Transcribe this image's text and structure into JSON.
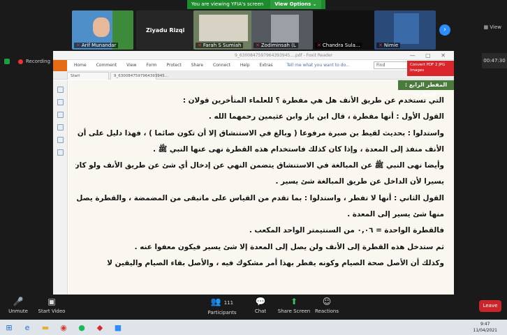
{
  "banner": {
    "viewing": "You are viewing YFIA's screen",
    "options": "View Options ⌄"
  },
  "participants": [
    {
      "name": "Arif Munandar",
      "bg": "#4f8fc9"
    },
    {
      "name": "Ziyadu Rizqi",
      "bg": "#262626"
    },
    {
      "name": "Farah S Sumiah",
      "bg": "#6d7f5e"
    },
    {
      "name": "Zodiminsah (L",
      "bg": "#555a60"
    },
    {
      "name": "Chandra Sula...",
      "bg": "#111"
    },
    {
      "name": "Nimie",
      "bg": "#2a4a7a"
    }
  ],
  "view_label": "View",
  "status": {
    "recording": "Recording",
    "timer": "00:47:30"
  },
  "app": {
    "title": "9_6300847597964393945....pdf - Foxit Reader",
    "menu": [
      "Home",
      "Comment",
      "View",
      "Form",
      "Protect",
      "Share",
      "Connect",
      "Help",
      "Extras"
    ],
    "tellme": "Tell me what you want to do...",
    "find": "Find",
    "convert": "Convert\nPDF 2 JPG Images",
    "tabs": [
      "Start",
      "9_6300847597964393945..."
    ]
  },
  "doc": {
    "header": "المفطر الرابع : القطرة",
    "lines": [
      "التي تستخدم عن طريق الأنف هل هي مفطرة ؟ للعلماء المتأخرين قولان :",
      "القول الأول : أنها مفطرة ، قال ابن باز وابن عثيمين رحمهما الله .",
      "واستدلوا : بحديث لقيط بن صبرة مرفوعا ( وبالغ في الاستنشاق إلا أن تكون صائما ) ، فهذا دليل على أن",
      "الأنف منفذ إلى المعدة ، وإذا كان كذلك فاستخدام هذه القطرة نهى عنها النبي ﷺ .",
      "وأيضا نهى النبي ﷺ عن المبالغة في الاستنشاق يتضمن النهي عن إدخال أي شئ عن طريق الأنف ولو كان",
      "يسيرا لأن الداخل عن طريق المبالغة شئ يسير .",
      "القول الثاني : أنها لا تفطر ، واستدلوا : بما تقدم من القياس على ماتبقى من المضمضة ، والقطرة يصل",
      "منها شئ يسير إلى المعدة .",
      "فالقطرة الواحدة = ٠,٠٦ من السنتيمتر الواحد المكعب .",
      "ثم ستدخل هذه القطرة إلى الأنف ولن يصل إلى المعدة إلا شئ يسير فيكون معفوا عنه .",
      "وكذلك أن الأصل صحة الصيام وكونه يفطر بهذا أمر مشكوك فيه ، والأصل بقاء الصيام واليقين لا"
    ]
  },
  "toolbar": {
    "unmute": "Unmute",
    "start_video": "Start Video",
    "participants": "Participants",
    "participants_count": "111",
    "chat": "Chat",
    "share": "Share Screen",
    "reactions": "Reactions",
    "leave": "Leave"
  },
  "clock": {
    "time": "9:47",
    "date": "11/04/2021"
  }
}
